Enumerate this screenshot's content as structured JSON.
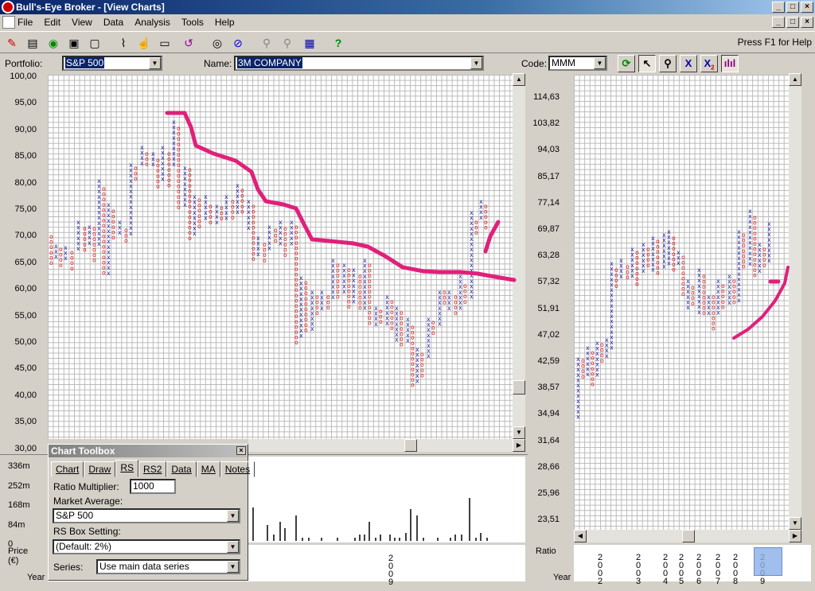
{
  "window": {
    "title": "Bull's-Eye Broker - [View Charts]",
    "buttons": [
      "_",
      "□",
      "×"
    ]
  },
  "menu": {
    "items": [
      "File",
      "Edit",
      "View",
      "Data",
      "Analysis",
      "Tools",
      "Help"
    ]
  },
  "toolbar": {
    "help_text": "Press F1 for Help"
  },
  "selector": {
    "portfolio_label": "Portfolio:",
    "portfolio_value": "S&P 500",
    "name_label": "Name:",
    "name_value": "3M COMPANY",
    "code_label": "Code:",
    "code_value": "MMM"
  },
  "left_chart": {
    "y_labels": [
      "100,00",
      "95,00",
      "90,00",
      "85,00",
      "80,00",
      "75,00",
      "70,00",
      "65,00",
      "60,00",
      "55,00",
      "50,00",
      "45,00",
      "40,00",
      "35,00",
      "30,00"
    ],
    "volume_labels": [
      "336m",
      "252m",
      "168m",
      "84m",
      "0"
    ],
    "price_label": "Price",
    "price_unit": "(€)",
    "year_label": "Year",
    "year_digits": [
      "2",
      "0",
      "0",
      "9"
    ]
  },
  "right_chart": {
    "y_labels": [
      "114,63",
      "103,82",
      "94,03",
      "85,17",
      "77,14",
      "69,87",
      "63,28",
      "57,32",
      "51,91",
      "47,02",
      "42,59",
      "38,57",
      "34,94",
      "31,64",
      "28,66",
      "25,96",
      "23,51"
    ],
    "ratio_label": "Ratio",
    "year_label": "Year",
    "years": [
      [
        "2",
        "0",
        "0",
        "2"
      ],
      [
        "2",
        "0",
        "0",
        "3"
      ],
      [
        "2",
        "0",
        "0",
        "4"
      ],
      [
        "2",
        "0",
        "0",
        "5"
      ],
      [
        "2",
        "0",
        "0",
        "6"
      ],
      [
        "2",
        "0",
        "0",
        "7"
      ],
      [
        "2",
        "0",
        "0",
        "8"
      ],
      [
        "2",
        "0",
        "0",
        "9"
      ]
    ]
  },
  "toolbox": {
    "title": "Chart Toolbox",
    "tabs": [
      "Chart",
      "Draw",
      "RS",
      "RS2",
      "Data",
      "MA",
      "Notes"
    ],
    "active_tab": "RS",
    "ratio_multiplier_label": "Ratio Multiplier:",
    "ratio_multiplier_value": "1000",
    "market_average_label": "Market Average:",
    "market_average_value": "S&P 500",
    "rs_box_label": "RS Box Setting:",
    "rs_box_value": "(Default: 2%)",
    "series_label": "Series:",
    "series_value": "Use main data series"
  },
  "colors": {
    "x_color": "#1a1aa0",
    "o_color": "#d01010",
    "annotation": "#e0207a"
  }
}
